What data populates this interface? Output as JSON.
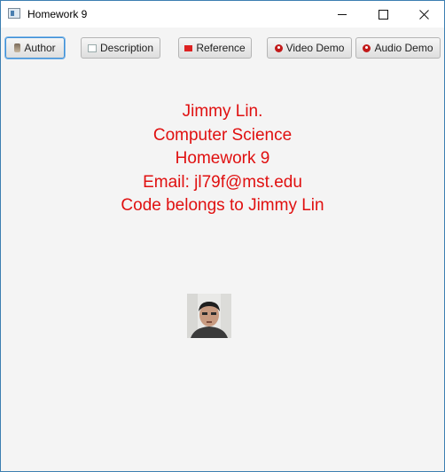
{
  "window": {
    "title": "Homework 9",
    "controls": [
      "minimize-icon",
      "maximize-icon",
      "close-icon"
    ]
  },
  "toolbar": {
    "buttons": [
      {
        "label": "Author",
        "icon": "author-icon"
      },
      {
        "label": "Description",
        "icon": "description-icon"
      },
      {
        "label": "Reference",
        "icon": "reference-icon"
      },
      {
        "label": "Video Demo",
        "icon": "video-demo-icon"
      },
      {
        "label": "Audio Demo",
        "icon": "audio-demo-icon"
      }
    ]
  },
  "content": {
    "lines": [
      "Jimmy Lin.",
      "Computer Science",
      "Homework 9",
      "Email: jl79f@mst.edu",
      "Code belongs to Jimmy Lin"
    ],
    "text_color": "#e01010",
    "photo": "author-photo"
  }
}
